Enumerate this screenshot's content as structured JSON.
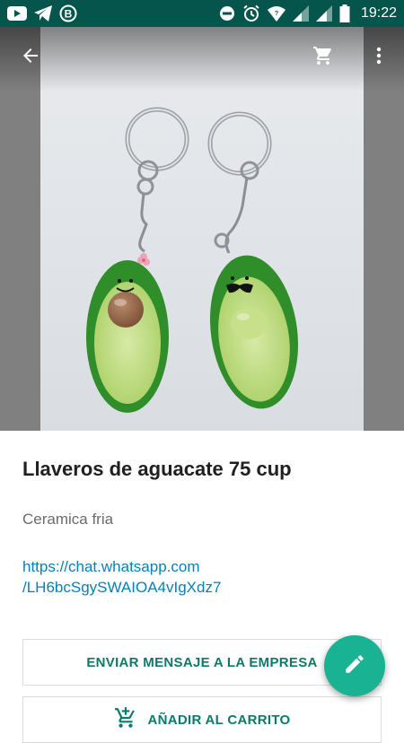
{
  "status_bar": {
    "time": "19:22",
    "left_icons": [
      "youtube-icon",
      "telegram-icon",
      "bitcoin-icon"
    ],
    "right_icons": [
      "do-not-disturb-icon",
      "alarm-icon",
      "wifi-icon",
      "signal-icon",
      "signal-icon",
      "battery-icon"
    ]
  },
  "header": {
    "back_icon": "arrow-back-icon",
    "cart_icon": "shopping-cart-icon",
    "menu_icon": "more-vert-icon"
  },
  "product": {
    "title": "Llaveros de aguacate 75 cup",
    "description": "Ceramica fria",
    "link_line1": "https://chat.whatsapp.com",
    "link_line2": "/LH6bcSgySWAIOA4vIgXdz7"
  },
  "actions": {
    "message_label": "ENVIAR MENSAJE A LA EMPRESA",
    "cart_label": "AÑADIR AL CARRITO",
    "cart_icon": "add-shopping-cart-icon",
    "fab_icon": "edit-pencil-icon"
  },
  "colors": {
    "status_bar": "#06554c",
    "accent": "#19b292",
    "link": "#0a7fb5",
    "button_text": "#0b7a6b"
  }
}
